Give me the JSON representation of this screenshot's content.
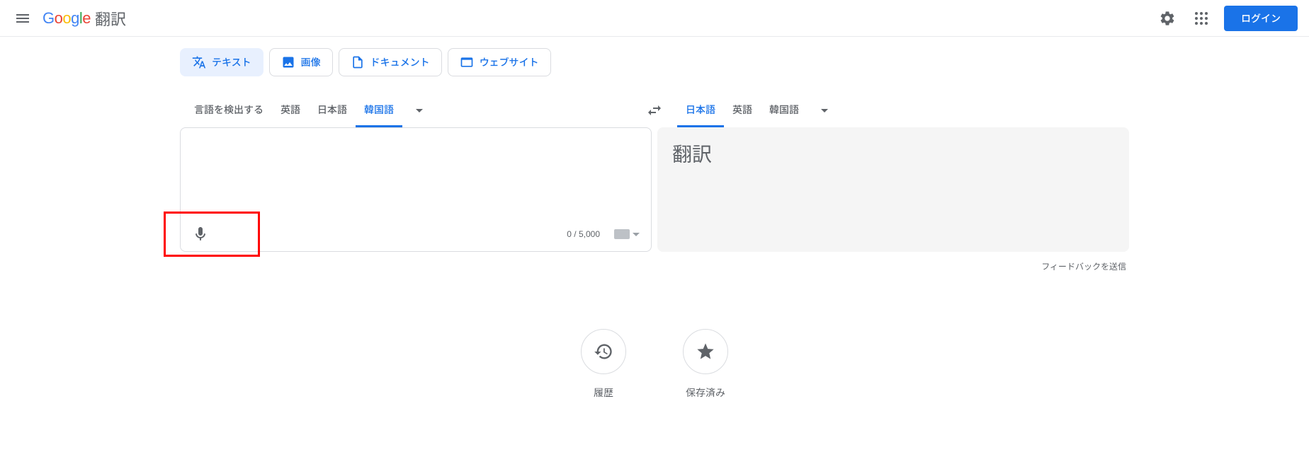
{
  "header": {
    "app_title": "翻訳",
    "login_label": "ログイン"
  },
  "input_tabs": {
    "text": "テキスト",
    "image": "画像",
    "document": "ドキュメント",
    "website": "ウェブサイト"
  },
  "source": {
    "langs": {
      "detect": "言語を検出する",
      "english": "英語",
      "japanese": "日本語",
      "korean": "韓国語"
    },
    "active": "korean",
    "char_count": "0 / 5,000"
  },
  "target": {
    "langs": {
      "japanese": "日本語",
      "english": "英語",
      "korean": "韓国語"
    },
    "active": "japanese",
    "placeholder": "翻訳"
  },
  "feedback_label": "フィードバックを送信",
  "bottom": {
    "history": "履歴",
    "saved": "保存済み"
  }
}
